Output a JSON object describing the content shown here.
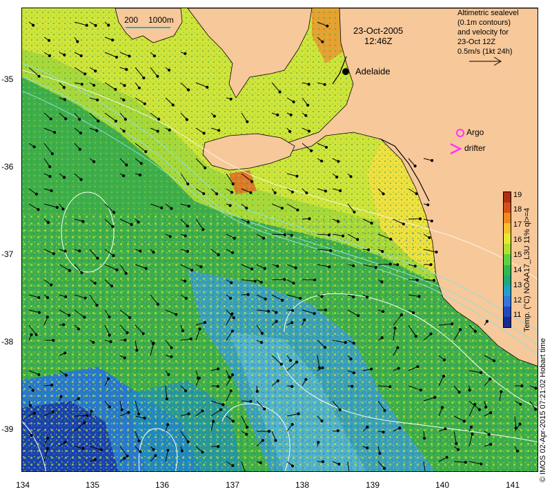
{
  "title": {
    "date": "23-Oct-2005",
    "time": "12:46Z"
  },
  "scale_bar": {
    "label_left": "200",
    "label_right": "1000m"
  },
  "legend": {
    "lines": [
      "Altimetric sealevel",
      "(0.1m contours)",
      "and velocity for",
      "23-Oct 12Z",
      "0.5m/s (1kt 24h)"
    ],
    "argo_label": "Argo",
    "drifter_label": "drifter",
    "argo_color": "#ff33ff",
    "drifter_color": "#ff33ff"
  },
  "place": {
    "name": "Adelaide"
  },
  "colorbar": {
    "title": "Temp. (°C) NOAA17_L3U 11% ql>=4",
    "ticks": [
      "19",
      "18",
      "17",
      "16",
      "15",
      "14",
      "13",
      "12",
      "11"
    ],
    "colors": [
      "#b03010",
      "#d45018",
      "#f08a20",
      "#f8c030",
      "#e8e830",
      "#b0e030",
      "#60d040",
      "#30b850",
      "#20a878",
      "#20a0c8",
      "#3078e0",
      "#2048c0",
      "#1a2a90"
    ]
  },
  "axes": {
    "lat_ticks": [
      "-35",
      "-36",
      "-37",
      "-38",
      "-39"
    ],
    "lon_ticks": [
      "134",
      "135",
      "136",
      "137",
      "138",
      "139",
      "140",
      "141"
    ]
  },
  "credit": "© IMOS 02-Apr-2015 07:21:02 Hobart time",
  "colors": {
    "land": "#f7c89a",
    "sea_warm": "#c8e030",
    "sea_mid": "#4ab84a",
    "sea_cool": "#3a9ed0",
    "sea_cold": "#1a48b0"
  }
}
